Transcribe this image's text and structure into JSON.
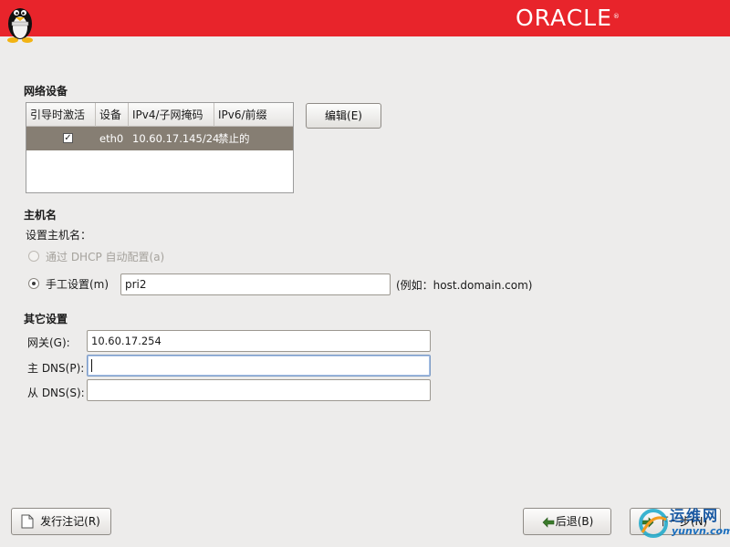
{
  "header": {
    "brand": "ORACLE",
    "reg_mark": "®",
    "colors": {
      "bar": "#e8242b",
      "logo_text": "#ffffff"
    }
  },
  "network": {
    "title": "网络设备",
    "columns": [
      "引导时激活",
      "设备",
      "IPv4/子网掩码",
      "IPv6/前缀"
    ],
    "rows": [
      {
        "active": true,
        "device": "eth0",
        "ipv4": "10.60.17.145/24",
        "ipv6": "禁止的"
      }
    ],
    "edit_button": "编辑(E)",
    "selected_row_color": "#867e73"
  },
  "hostname": {
    "title": "主机名",
    "subtitle": "设置主机名：",
    "option_dhcp": "通过 DHCP 自动配置(a)",
    "option_manual": "手工设置(m)",
    "manual_selected": true,
    "value": "pri2",
    "example": "(例如：host.domain.com)"
  },
  "other": {
    "title": "其它设置",
    "gateway_label": "网关(G):",
    "gateway_value": "10.60.17.254",
    "dns1_label": "主 DNS(P):",
    "dns1_value": "",
    "dns2_label": "从 DNS(S):",
    "dns2_value": ""
  },
  "footer": {
    "release_notes": "发行注记(R)",
    "back": "后退(B)",
    "next": "下一步(N)",
    "watermark_text": "运维网",
    "watermark_url": "yunvn.com"
  }
}
